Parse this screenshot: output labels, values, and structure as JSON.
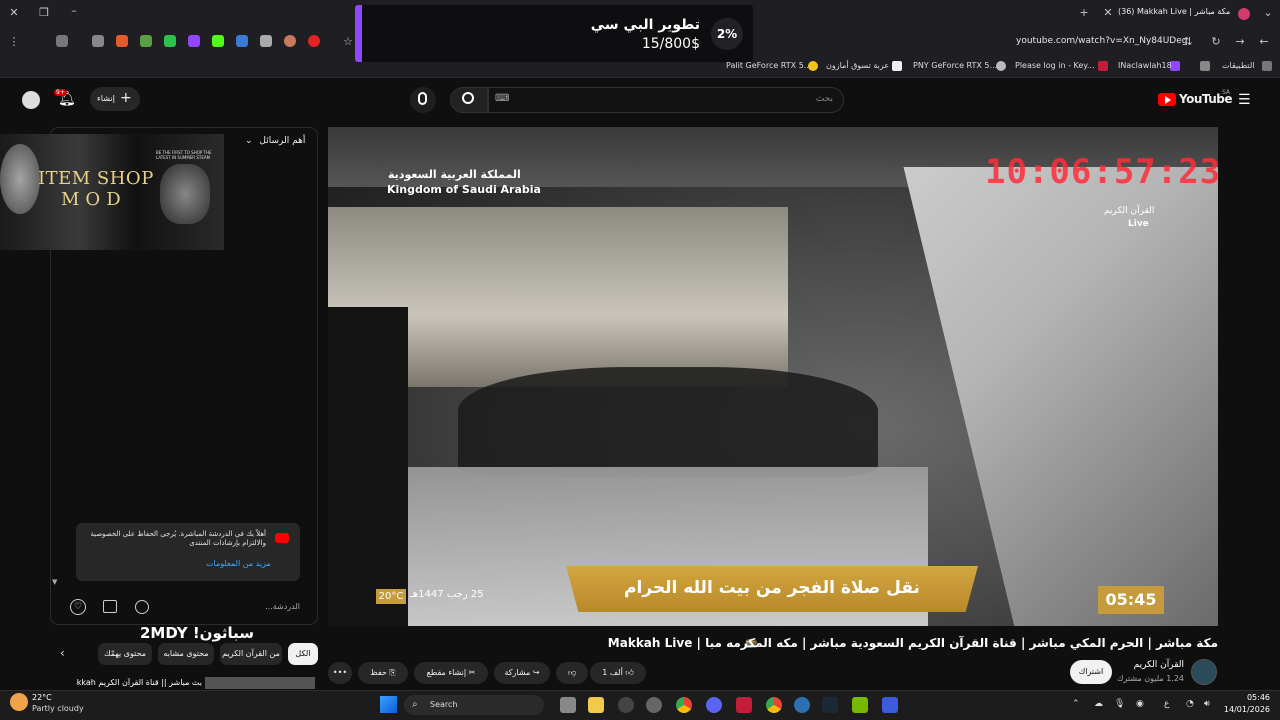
{
  "browser": {
    "tab_title": "(36) Makkah Live | مكة مباشر",
    "url": "youtube.com/watch?v=Xn_Ny84UDeg",
    "bookmarks": [
      "التطبيقات",
      "INaclawlah18",
      "Please log in - Key...",
      "PNY GeForce RTX 5...",
      "عربة تسوق أمازون",
      "Palit GeForce RTX 5..."
    ]
  },
  "alert": {
    "title": "تطوير البي سي",
    "amount": "15/800$",
    "percent": "2%",
    "accent": "#9146ff"
  },
  "header": {
    "logo_text": "YouTube",
    "region": "SA",
    "search_placeholder": "بحث",
    "create_label": "إنشاء",
    "notifications_badge": "9+",
    "keyboard_hint": "⌨"
  },
  "chat": {
    "header": "أهم الرسائل",
    "banner_line1": "ITEM SHOP",
    "banner_line2": "MOD",
    "banner_small": "BE THE FIRST TO SHOP THE LATEST IN SUMMER STEAM",
    "notice_text": "أهلاً بك في الدردشة المباشرة. يُرجى الحفاظ على الخصوصية والالتزام بإرشادات المنتدى",
    "notice_link": "مزيد من المعلومات",
    "input_placeholder": "الدردشة..."
  },
  "video": {
    "clock_overlay": "10:06:57:23",
    "ksa_ar": "المملكة العربية السعودية",
    "ksa_en": "Kingdom of Saudi Arabia",
    "channel_overlay": "القرآن الكريم",
    "live_label": "Live",
    "banner": "نقل صلاة الفجر من بيت الله الحرام",
    "time": "05:45",
    "temp": "20°C",
    "hijri": "25 رجب 1447هـ",
    "accent_gold": "#c59b3d"
  },
  "below": {
    "title": "مكة مباشر | الحرم المكي مباشر | قناة القرآن الكريم السعودية مباشر | مكه المكرمه مبا | Makkah Live",
    "channel_name": "القرآن الكريم",
    "channel_subs": "1.24 مليون مشترك",
    "subscribe": "اشتراك",
    "like_count": "1 ألف",
    "share": "مشاركة",
    "clip": "إنشاء مقطع",
    "save": "حفظ",
    "more": "•••"
  },
  "recommend": {
    "banner": "سباثون! 2MDY",
    "chips": [
      "الكل",
      "من القرآن الكريم",
      "محتوى مشابه",
      "محتوى يهمّك"
    ],
    "first_title": "بث مباشر || قناة القرآن الكريم Makkah"
  },
  "taskbar": {
    "weather_temp": "22°C",
    "weather_desc": "Partly cloudy",
    "search": "Search",
    "time": "05:46",
    "date": "14/01/2026",
    "lang": "ع"
  }
}
